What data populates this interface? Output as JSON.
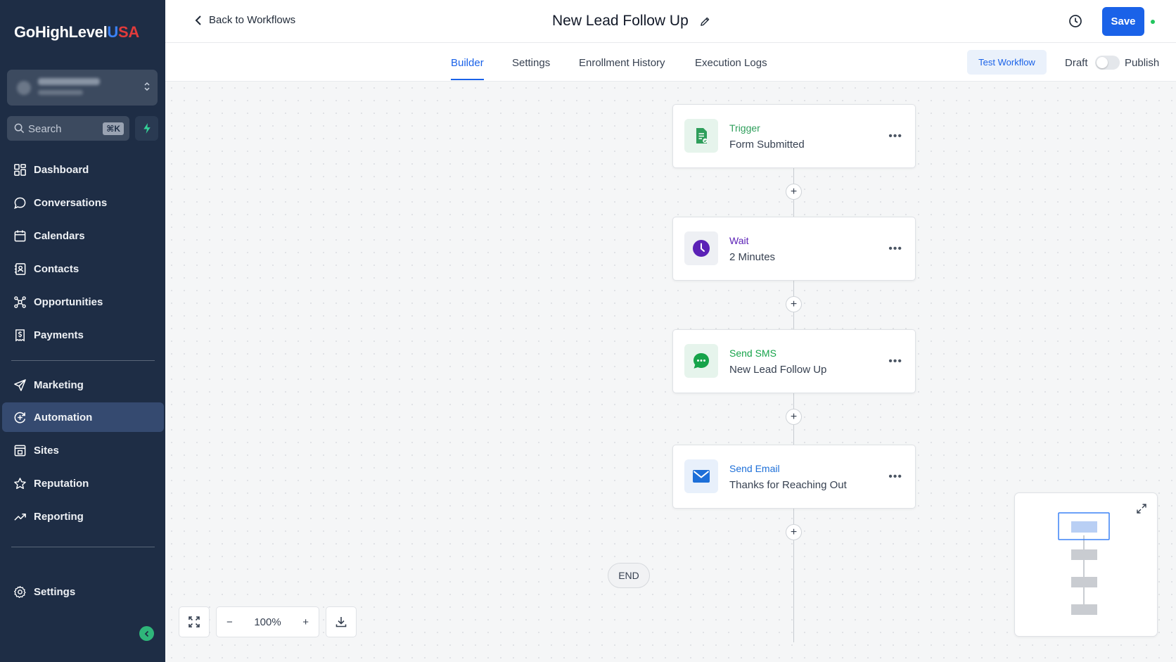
{
  "brand": {
    "name_main": "GoHighLevel",
    "name_accent_u": "U",
    "name_accent_sa": "SA"
  },
  "sidebar": {
    "search_label": "Search",
    "search_shortcut": "⌘K",
    "items": [
      {
        "label": "Dashboard",
        "icon": "dashboard-icon"
      },
      {
        "label": "Conversations",
        "icon": "chat-icon"
      },
      {
        "label": "Calendars",
        "icon": "calendar-icon"
      },
      {
        "label": "Contacts",
        "icon": "contacts-icon"
      },
      {
        "label": "Opportunities",
        "icon": "opportunities-icon"
      },
      {
        "label": "Payments",
        "icon": "payments-icon"
      },
      {
        "label": "Marketing",
        "icon": "send-icon"
      },
      {
        "label": "Automation",
        "icon": "automation-icon",
        "active": true
      },
      {
        "label": "Sites",
        "icon": "sites-icon"
      },
      {
        "label": "Reputation",
        "icon": "star-icon"
      },
      {
        "label": "Reporting",
        "icon": "trend-icon"
      },
      {
        "label": "Settings",
        "icon": "gear-icon"
      }
    ]
  },
  "header": {
    "back_label": "Back to Workflows",
    "title": "New Lead Follow Up",
    "save_label": "Save"
  },
  "tabs": [
    {
      "label": "Builder",
      "active": true
    },
    {
      "label": "Settings"
    },
    {
      "label": "Enrollment History"
    },
    {
      "label": "Execution Logs"
    }
  ],
  "actions": {
    "test_label": "Test Workflow",
    "draft_label": "Draft",
    "publish_label": "Publish",
    "published": false
  },
  "workflow": {
    "nodes": [
      {
        "type": "Trigger",
        "detail": "Form Submitted",
        "color": "#2e9e5b"
      },
      {
        "type": "Wait",
        "detail": "2 Minutes",
        "color": "#5b21b6"
      },
      {
        "type": "Send SMS",
        "detail": "New Lead Follow Up",
        "color": "#16a34a"
      },
      {
        "type": "Send Email",
        "detail": "Thanks for Reaching Out",
        "color": "#1d6fd8"
      }
    ],
    "add_symbol": "+",
    "end_label": "END"
  },
  "canvas_controls": {
    "zoom": "100%",
    "minus": "−",
    "plus": "+"
  },
  "colors": {
    "sidebar_bg": "#1e2d45",
    "accent": "#1a62e8",
    "active_nav": "#354a70"
  }
}
